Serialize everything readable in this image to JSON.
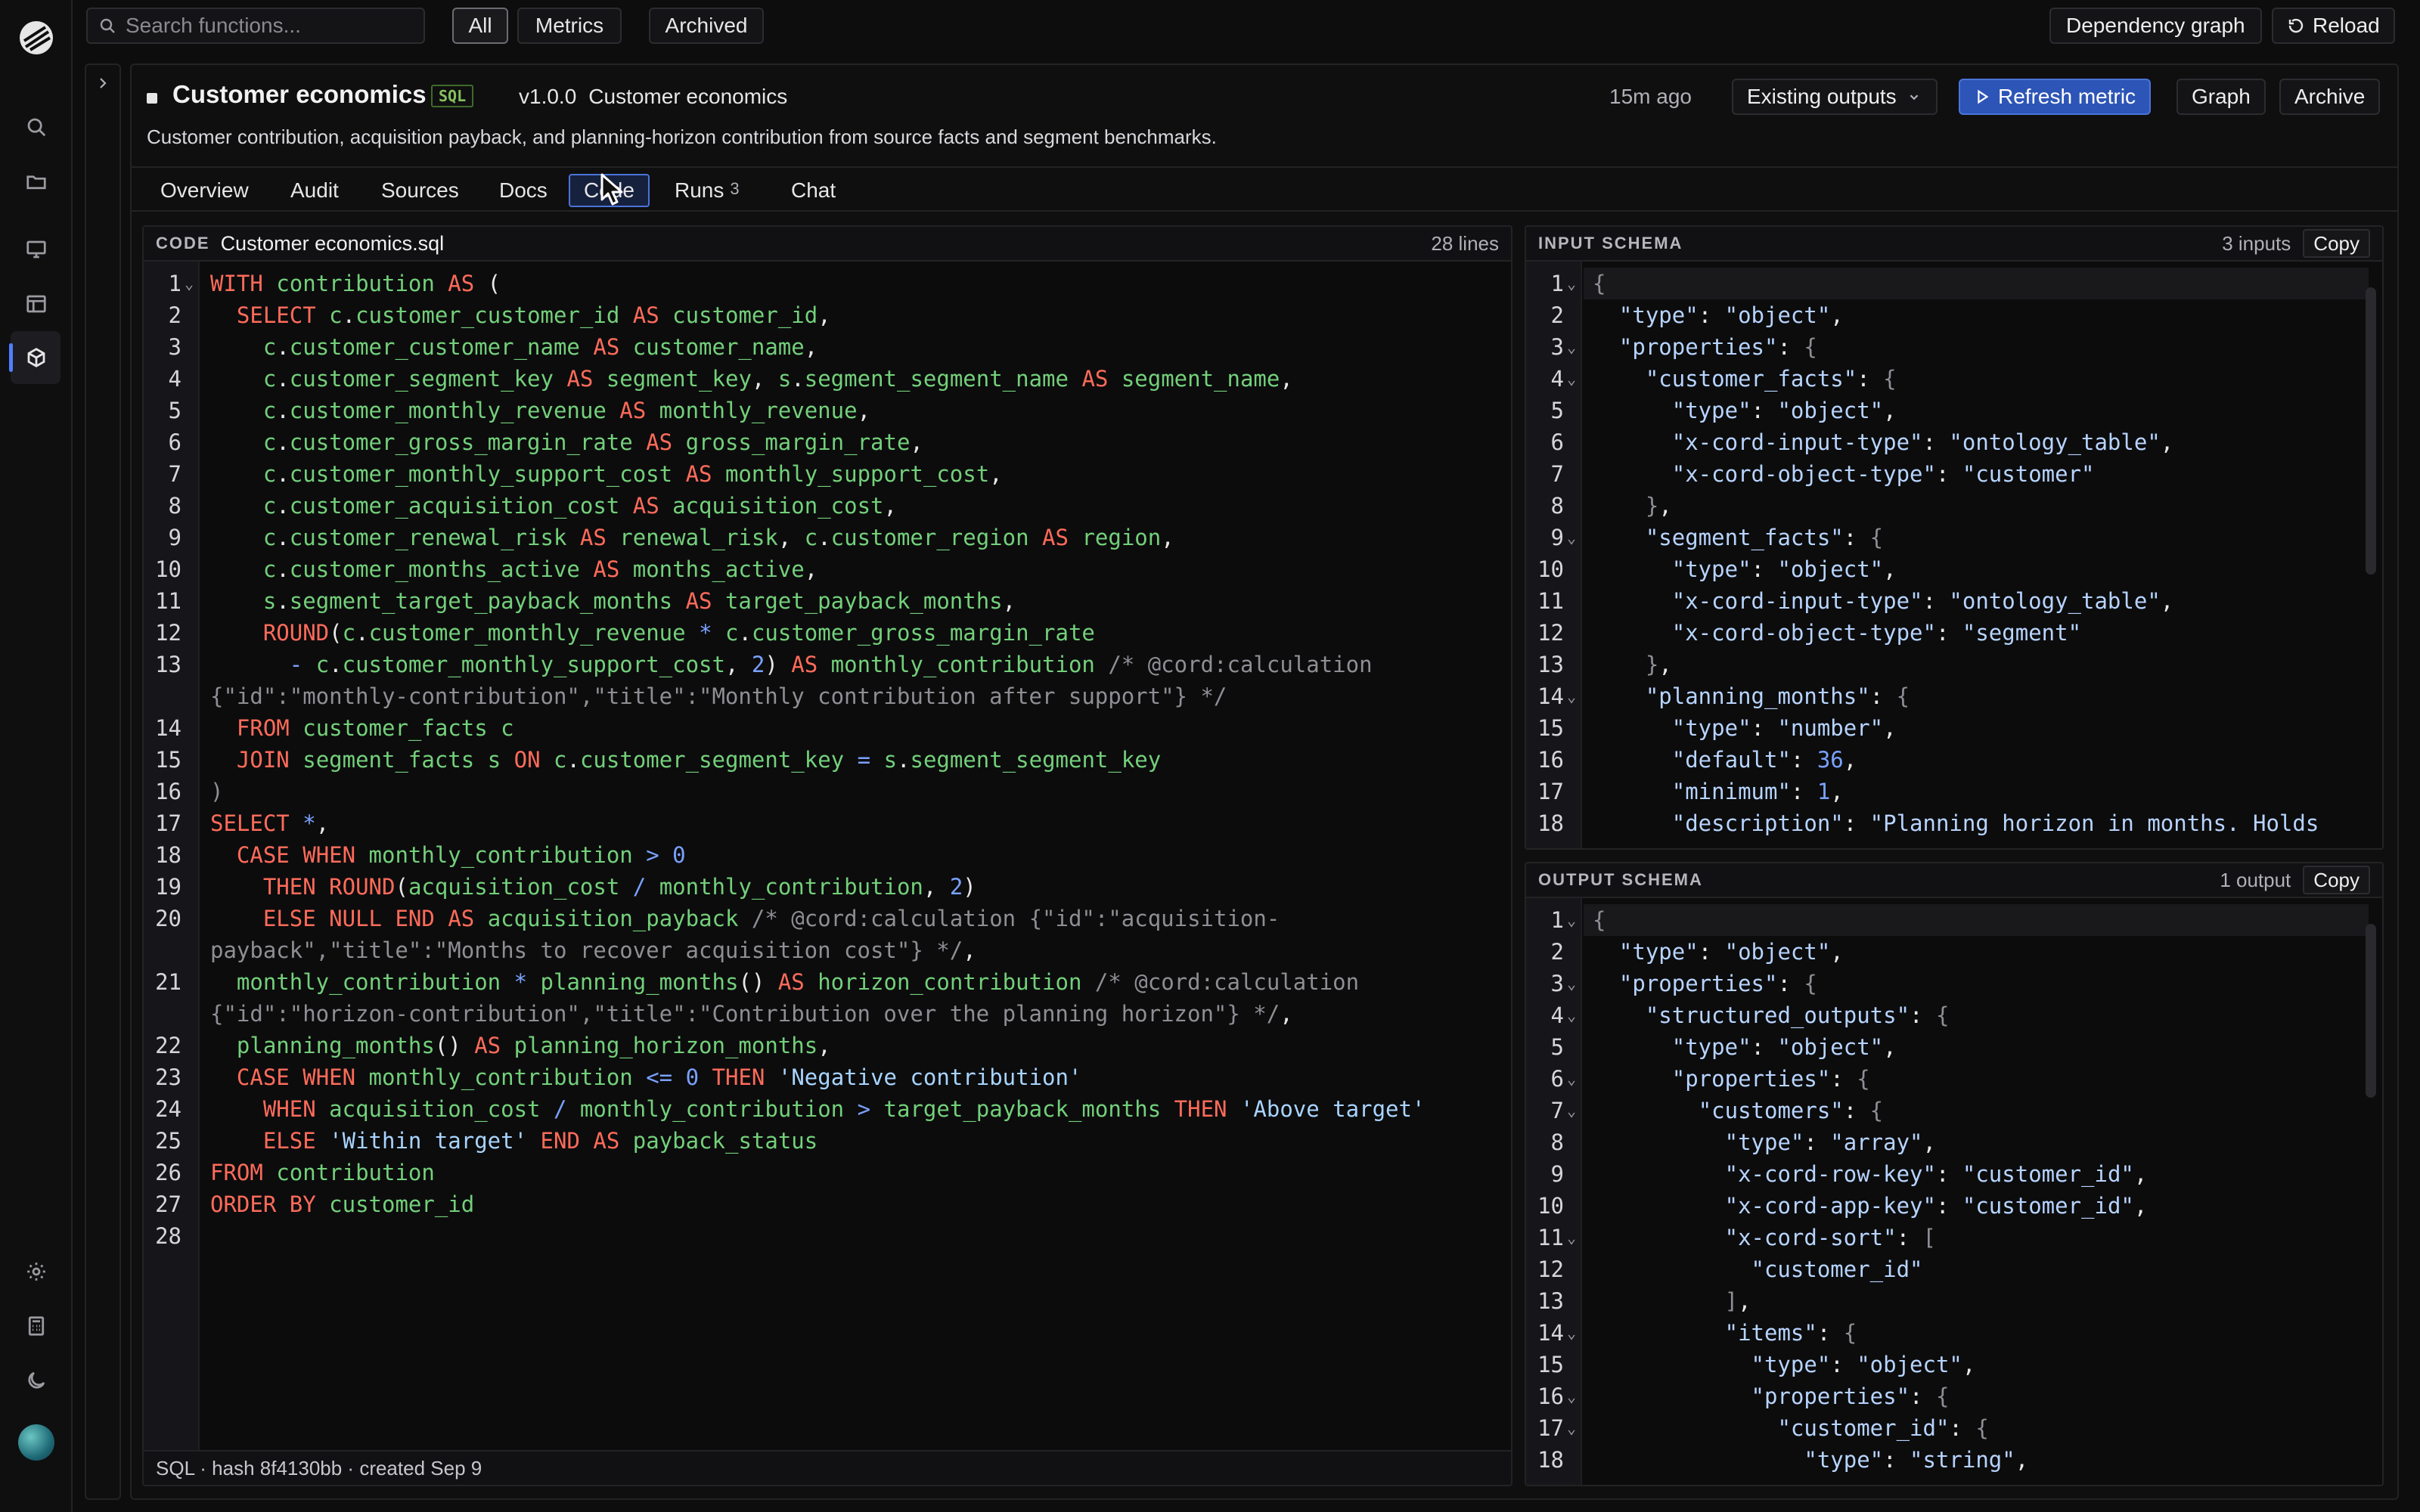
{
  "topbar": {
    "search_placeholder": "Search functions...",
    "filters": [
      {
        "label": "All",
        "active": true
      },
      {
        "label": "Metrics",
        "active": false
      },
      {
        "label": "Archived",
        "active": false
      }
    ],
    "dependency_graph": "Dependency graph",
    "reload": "Reload"
  },
  "rail": {
    "icons": [
      "logo-icon",
      "search-icon",
      "folder-icon",
      "monitor-icon",
      "layout-icon",
      "cube-icon",
      "settings-icon",
      "calculator-icon",
      "moon-icon"
    ]
  },
  "header": {
    "title": "Customer economics",
    "badge": "SQL",
    "version": "v1.0.0",
    "version_name": "Customer economics",
    "updated": "15m ago",
    "existing_outputs": "Existing outputs",
    "refresh": "Refresh metric",
    "graph": "Graph",
    "archive": "Archive",
    "description": "Customer contribution, acquisition payback, and planning-horizon contribution from source facts and segment benchmarks."
  },
  "tabs": [
    {
      "label": "Overview"
    },
    {
      "label": "Audit"
    },
    {
      "label": "Sources"
    },
    {
      "label": "Docs"
    },
    {
      "label": "Code",
      "active": true
    },
    {
      "label": "Runs",
      "count": "3"
    },
    {
      "label": "Chat"
    }
  ],
  "code_panel": {
    "label": "CODE",
    "file": "Customer economics.sql",
    "lines_count": "28 lines",
    "footer": "SQL · hash 8f4130bb · created Sep 9"
  },
  "input_panel": {
    "label": "INPUT SCHEMA",
    "meta": "3 inputs",
    "copy": "Copy"
  },
  "output_panel": {
    "label": "OUTPUT SCHEMA",
    "meta": "1 output",
    "copy": "Copy"
  },
  "colors": {
    "accent": "#2d55b8",
    "keyword": "#ff6b5a",
    "identifier": "#73d07a",
    "number": "#7aa2ff",
    "comment": "#8e8e94"
  }
}
